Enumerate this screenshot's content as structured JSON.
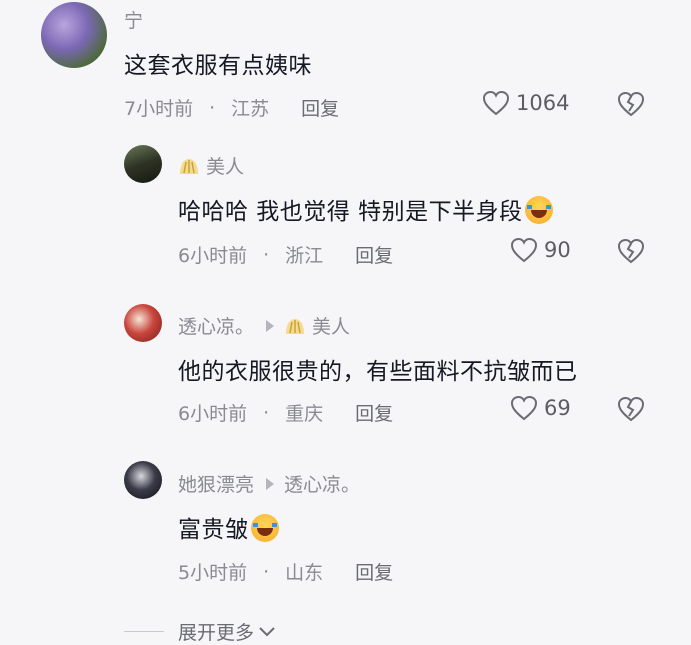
{
  "comments": [
    {
      "user": "宁",
      "text": "这套衣服有点姨味",
      "time": "7小时前",
      "location": "江苏",
      "reply_label": "回复",
      "likes": "1064",
      "avatar": "purple-flower-photo"
    },
    {
      "user": "美人",
      "text": "哈哈哈 我也觉得 特别是下半身段",
      "emoji": "laugh-cry-emoji",
      "time": "6小时前",
      "location": "浙江",
      "reply_label": "回复",
      "likes": "90",
      "avatar": "dark-road-photo"
    },
    {
      "user": "透心凉。",
      "reply_to": "美人",
      "text": "他的衣服很贵的，有些面料不抗皱而已",
      "time": "6小时前",
      "location": "重庆",
      "reply_label": "回复",
      "likes": "69",
      "avatar": "red-portrait-photo"
    },
    {
      "user": "她狠漂亮",
      "reply_to": "透心凉。",
      "text": "富贵皱",
      "emoji": "laugh-cry-emoji",
      "time": "5小时前",
      "location": "山东",
      "reply_label": "回复",
      "avatar": "night-portrait-photo"
    }
  ],
  "expand_label": "展开更多",
  "colors": {
    "background": "#f6f6f8",
    "text": "#161823",
    "secondary": "#8a8b91"
  }
}
